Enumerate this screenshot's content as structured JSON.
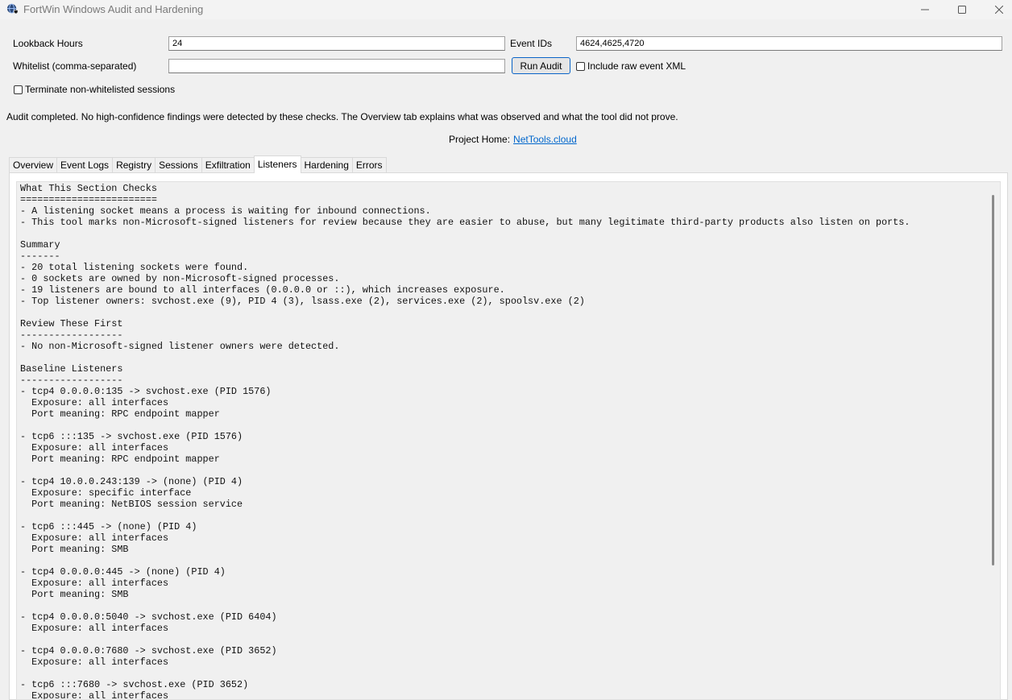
{
  "window": {
    "title": "FortWin Windows Audit and Hardening",
    "app_icon": "shield-globe-icon",
    "controls": [
      "minimize-icon",
      "maximize-icon",
      "close-icon"
    ]
  },
  "form": {
    "lookback_label": "Lookback Hours",
    "lookback_value": "24",
    "event_ids_label": "Event IDs",
    "event_ids_value": "4624,4625,4720",
    "whitelist_label": "Whitelist (comma-separated)",
    "whitelist_value": "",
    "run_button": "Run Audit",
    "include_xml_label": "Include raw event XML",
    "terminate_label": "Terminate non-whitelisted sessions"
  },
  "status": "Audit completed. No high-confidence findings were detected by these checks. The Overview tab explains what was observed and what the tool did not prove.",
  "project_home": {
    "label": "Project Home:",
    "link": "NetTools.cloud"
  },
  "tabs": [
    {
      "label": "Overview"
    },
    {
      "label": "Event Logs"
    },
    {
      "label": "Registry"
    },
    {
      "label": "Sessions"
    },
    {
      "label": "Exfiltration"
    },
    {
      "label": "Listeners",
      "active": true
    },
    {
      "label": "Hardening"
    },
    {
      "label": "Errors"
    }
  ],
  "output": {
    "lines": [
      "What This Section Checks",
      "========================",
      "- A listening socket means a process is waiting for inbound connections.",
      "- This tool marks non-Microsoft-signed listeners for review because they are easier to abuse, but many legitimate third-party products also listen on ports.",
      "",
      "Summary",
      "-------",
      "- 20 total listening sockets were found.",
      "- 0 sockets are owned by non-Microsoft-signed processes.",
      "- 19 listeners are bound to all interfaces (0.0.0.0 or ::), which increases exposure.",
      "- Top listener owners: svchost.exe (9), PID 4 (3), lsass.exe (2), services.exe (2), spoolsv.exe (2)",
      "",
      "Review These First",
      "------------------",
      "- No non-Microsoft-signed listener owners were detected.",
      "",
      "Baseline Listeners",
      "------------------",
      "- tcp4 0.0.0.0:135 -> svchost.exe (PID 1576)",
      "  Exposure: all interfaces",
      "  Port meaning: RPC endpoint mapper",
      "",
      "- tcp6 :::135 -> svchost.exe (PID 1576)",
      "  Exposure: all interfaces",
      "  Port meaning: RPC endpoint mapper",
      "",
      "- tcp4 10.0.0.243:139 -> (none) (PID 4)",
      "  Exposure: specific interface",
      "  Port meaning: NetBIOS session service",
      "",
      "- tcp6 :::445 -> (none) (PID 4)",
      "  Exposure: all interfaces",
      "  Port meaning: SMB",
      "",
      "- tcp4 0.0.0.0:445 -> (none) (PID 4)",
      "  Exposure: all interfaces",
      "  Port meaning: SMB",
      "",
      "- tcp4 0.0.0.0:5040 -> svchost.exe (PID 6404)",
      "  Exposure: all interfaces",
      "",
      "- tcp4 0.0.0.0:7680 -> svchost.exe (PID 3652)",
      "  Exposure: all interfaces",
      "",
      "- tcp6 :::7680 -> svchost.exe (PID 3652)",
      "  Exposure: all interfaces"
    ]
  }
}
